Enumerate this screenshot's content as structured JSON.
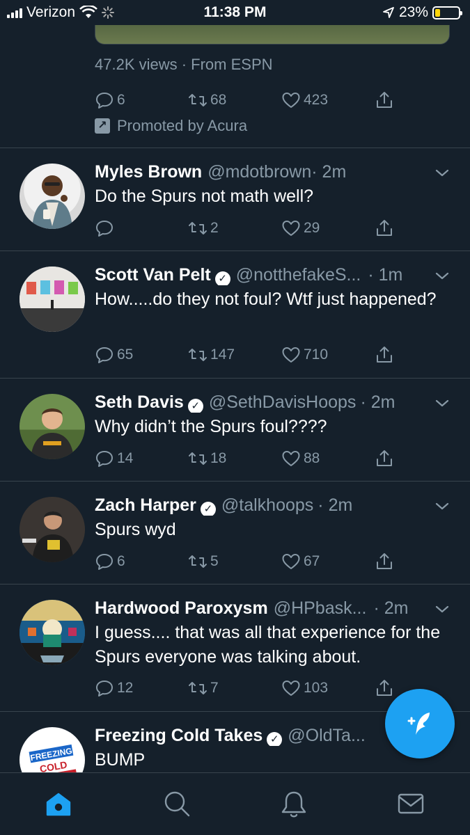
{
  "status_bar": {
    "carrier": "Verizon",
    "time": "11:38 PM",
    "battery_pct": "23%",
    "battery_level": 0.23
  },
  "promo": {
    "views": "47.2K views · From ESPN",
    "replies": "6",
    "retweets": "68",
    "likes": "423",
    "promoted": "Promoted by Acura"
  },
  "tweets": [
    {
      "name": "Myles Brown",
      "verified": false,
      "handle": "@mdotbrown",
      "time": "· 2m",
      "text": "Do the Spurs not math well?",
      "replies": "",
      "retweets": "2",
      "likes": "29"
    },
    {
      "name": "Scott Van Pelt",
      "verified": true,
      "handle": "@notthefakeS...",
      "time": "· 1m",
      "text": "How.....do they not foul? Wtf just happened?",
      "replies": "65",
      "retweets": "147",
      "likes": "710"
    },
    {
      "name": "Seth Davis",
      "verified": true,
      "handle": "@SethDavisHoops",
      "time": "· 2m",
      "text": "Why didn’t the Spurs foul????",
      "replies": "14",
      "retweets": "18",
      "likes": "88"
    },
    {
      "name": "Zach Harper",
      "verified": true,
      "handle": "@talkhoops",
      "time": "· 2m",
      "text": "Spurs wyd",
      "replies": "6",
      "retweets": "5",
      "likes": "67"
    },
    {
      "name": "Hardwood Paroxysm",
      "verified": false,
      "handle": "@HPbask...",
      "time": "· 2m",
      "text": "I guess.... that was all that experience for the Spurs everyone was talking about.",
      "replies": "12",
      "retweets": "7",
      "likes": "103"
    },
    {
      "name": "Freezing Cold Takes",
      "verified": true,
      "handle": "@OldTa...",
      "time": "",
      "text": "BUMP",
      "replies": "",
      "retweets": "",
      "likes": ""
    }
  ],
  "avatar_text": {
    "freezing_logo": "FREEZING COLD TAKES"
  },
  "colors": {
    "background": "#15202b",
    "divider": "#38444d",
    "secondary_text": "#8899a6",
    "accent": "#1da1f2"
  },
  "icons": [
    "reply-icon",
    "retweet-icon",
    "like-icon",
    "share-icon",
    "caret-down-icon",
    "compose-icon",
    "home-icon",
    "search-icon",
    "notifications-icon",
    "messages-icon"
  ]
}
